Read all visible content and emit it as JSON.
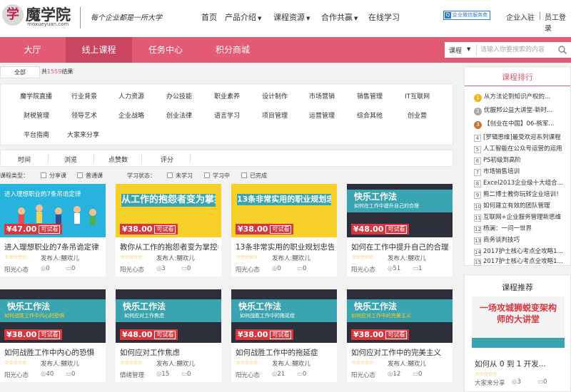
{
  "brand": {
    "name": "魔学院",
    "domain": "moxueyuan.com",
    "slogan": "每个企业都是一所大学",
    "logo_char": "学"
  },
  "top_nav": [
    {
      "label": "首页",
      "has_dropdown": false
    },
    {
      "label": "产品介绍",
      "has_dropdown": true
    },
    {
      "label": "课程资源",
      "has_dropdown": true
    },
    {
      "label": "合作共赢",
      "has_dropdown": true
    },
    {
      "label": "在线学习",
      "has_dropdown": false
    }
  ],
  "service_badge": "企业微信服务商",
  "top_links": {
    "enterprise_login": "企业入驻",
    "staff_login": "员工登录"
  },
  "red_nav": [
    {
      "label": "大厅",
      "active": false
    },
    {
      "label": "线上课程",
      "active": true
    },
    {
      "label": "任务中心",
      "active": false
    },
    {
      "label": "积分商城",
      "active": false
    }
  ],
  "search": {
    "category": "课程",
    "placeholder": "请输入你要搜索的内容"
  },
  "filter_all": "全部",
  "total": {
    "prefix": "共",
    "count": "1559",
    "suffix": "结果"
  },
  "categories": [
    "魔学院直播",
    "行业背景",
    "人力资源",
    "办公技能",
    "职业素养",
    "设计制作",
    "市场营销",
    "销售管理",
    "IT互联网",
    "财税管理",
    "领导艺术",
    "企业战略",
    "创业法律",
    "语言学习",
    "项目管理",
    "运营管理",
    "综合其他",
    "创业营",
    "平台指南",
    "大家来分享"
  ],
  "sort_tabs": [
    "时间",
    "浏览",
    "点赞数",
    "评分"
  ],
  "course_type": {
    "label": "课程类型：",
    "options": [
      "分享课",
      "普通课"
    ]
  },
  "study_status": {
    "label": "学习状态：",
    "options": [
      "未学习",
      "学习中",
      "已完成"
    ]
  },
  "courses": [
    {
      "title": "进入理想职业的7条吊诡定律",
      "price": "¥47.00",
      "trial": "可试看",
      "thumb_text": "进入理想职业的7条吊诡定律",
      "thumb_sub": "",
      "publisher": "发布人:嬲欢儿",
      "category": "阳光心态",
      "views": "0",
      "comments": "0",
      "stars": "☆☆☆☆☆"
    },
    {
      "title": "教你从工作的抱怨者变为掌控者",
      "price": "¥38.00",
      "trial": "可试看",
      "thumb_text": "从工作的抱怨者变为掌控者",
      "thumb_sub": "",
      "publisher": "发布人:嬲欢儿",
      "category": "阳光心态",
      "views": "3",
      "comments": "0",
      "stars": "☆☆☆☆☆"
    },
    {
      "title": "13条非常实用的职业规划忠告",
      "price": "¥38.00",
      "trial": "可试看",
      "thumb_text": "13条非常实用的职业规划忠告",
      "thumb_sub": "",
      "publisher": "发布人:嬲欢儿",
      "category": "阳光心态",
      "views": "0",
      "comments": "0",
      "stars": "☆☆☆☆☆"
    },
    {
      "title": "如何在工作中提升自己的合理",
      "price": "¥48.00",
      "trial": "可试看",
      "thumb_text": "快乐工作法",
      "thumb_sub": "如何在工作中提升自己的合理",
      "publisher": "发布人:嬲欢儿",
      "category": "阳光心态",
      "views": "51",
      "comments": "1",
      "stars": "☆☆☆☆☆"
    },
    {
      "title": "如何战胜工作中内心的恐惧",
      "price": "¥38.00",
      "trial": "可试看",
      "thumb_text": "快乐工作法",
      "thumb_sub": "如何战胜工作中内心的恐惧",
      "publisher": "发布人:嬲欢儿",
      "category": "阳光心态",
      "views": "40",
      "comments": "0",
      "stars": "☆☆☆☆☆"
    },
    {
      "title": "如何应对工作焦虑",
      "price": "¥48.00",
      "trial": "可试看",
      "thumb_text": "快乐工作法",
      "thumb_sub": "如何应对工作焦虑",
      "publisher": "发布人:嬲欢儿",
      "category": "情绪管理",
      "views": "15",
      "comments": "0",
      "stars": "☆☆☆☆☆"
    },
    {
      "title": "如何战胜工作中的拖延症",
      "price": "¥38.00",
      "trial": "可试看",
      "thumb_text": "快乐工作法",
      "thumb_sub": "如何战胜工作中的拖延症",
      "publisher": "发布人:嬲欢儿",
      "category": "阳光心态",
      "views": "21",
      "comments": "0",
      "stars": "☆☆☆☆☆"
    },
    {
      "title": "如何应对工作中的完美主义",
      "price": "¥38.00",
      "trial": "可试看",
      "thumb_text": "快乐工作法",
      "thumb_sub": "如何应对工作中的完美主义",
      "publisher": "发布人:嬲欢儿",
      "category": "阳光心态",
      "views": "12",
      "comments": "0",
      "stars": "☆☆☆☆☆"
    }
  ],
  "ranking": {
    "title": "课程排行",
    "items": [
      {
        "rank": "1",
        "title": "从方法论到知识产权的..."
      },
      {
        "rank": "2",
        "title": "优服邦公益大讲堂-新时..."
      },
      {
        "rank": "3",
        "title": "【创业在中国】06-熊军..."
      },
      {
        "rank": "4",
        "title": "[罗辑思维]最受欢迎系列课程"
      },
      {
        "rank": "5",
        "title": "人工智能在公众号运营的运用"
      },
      {
        "rank": "6",
        "title": "PS初级到高阶"
      },
      {
        "rank": "7",
        "title": "市场销售培训"
      },
      {
        "rank": "8",
        "title": "Excel2013企业级十大组合..."
      },
      {
        "rank": "9",
        "title": "熊二博士教你玩转企业培训！"
      },
      {
        "rank": "10",
        "title": "如何建立有效的团队管理"
      },
      {
        "rank": "11",
        "title": "互联网+企业服务管理新思维"
      },
      {
        "rank": "12",
        "title": "杨澜：一问一世界"
      },
      {
        "rank": "13",
        "title": "商务谈判技巧"
      },
      {
        "rank": "14",
        "title": "2017护士核心考点全攻略1..."
      },
      {
        "rank": "15",
        "title": "2017护士核心考点全攻略1..."
      }
    ]
  },
  "recommend": {
    "title": "课程推荐",
    "thumb_text": "一场攻城狮蜕变架构师的大讲堂",
    "course_title": "如何从 0 到 1 开发...",
    "stars": "☆☆☆☆☆",
    "category": "大家来分享",
    "views": "3",
    "comments": "0"
  },
  "colors": {
    "accent": "#e35a74",
    "price": "#d9363e",
    "teal": "#3aa5b0",
    "yellow": "#f7d12a"
  }
}
